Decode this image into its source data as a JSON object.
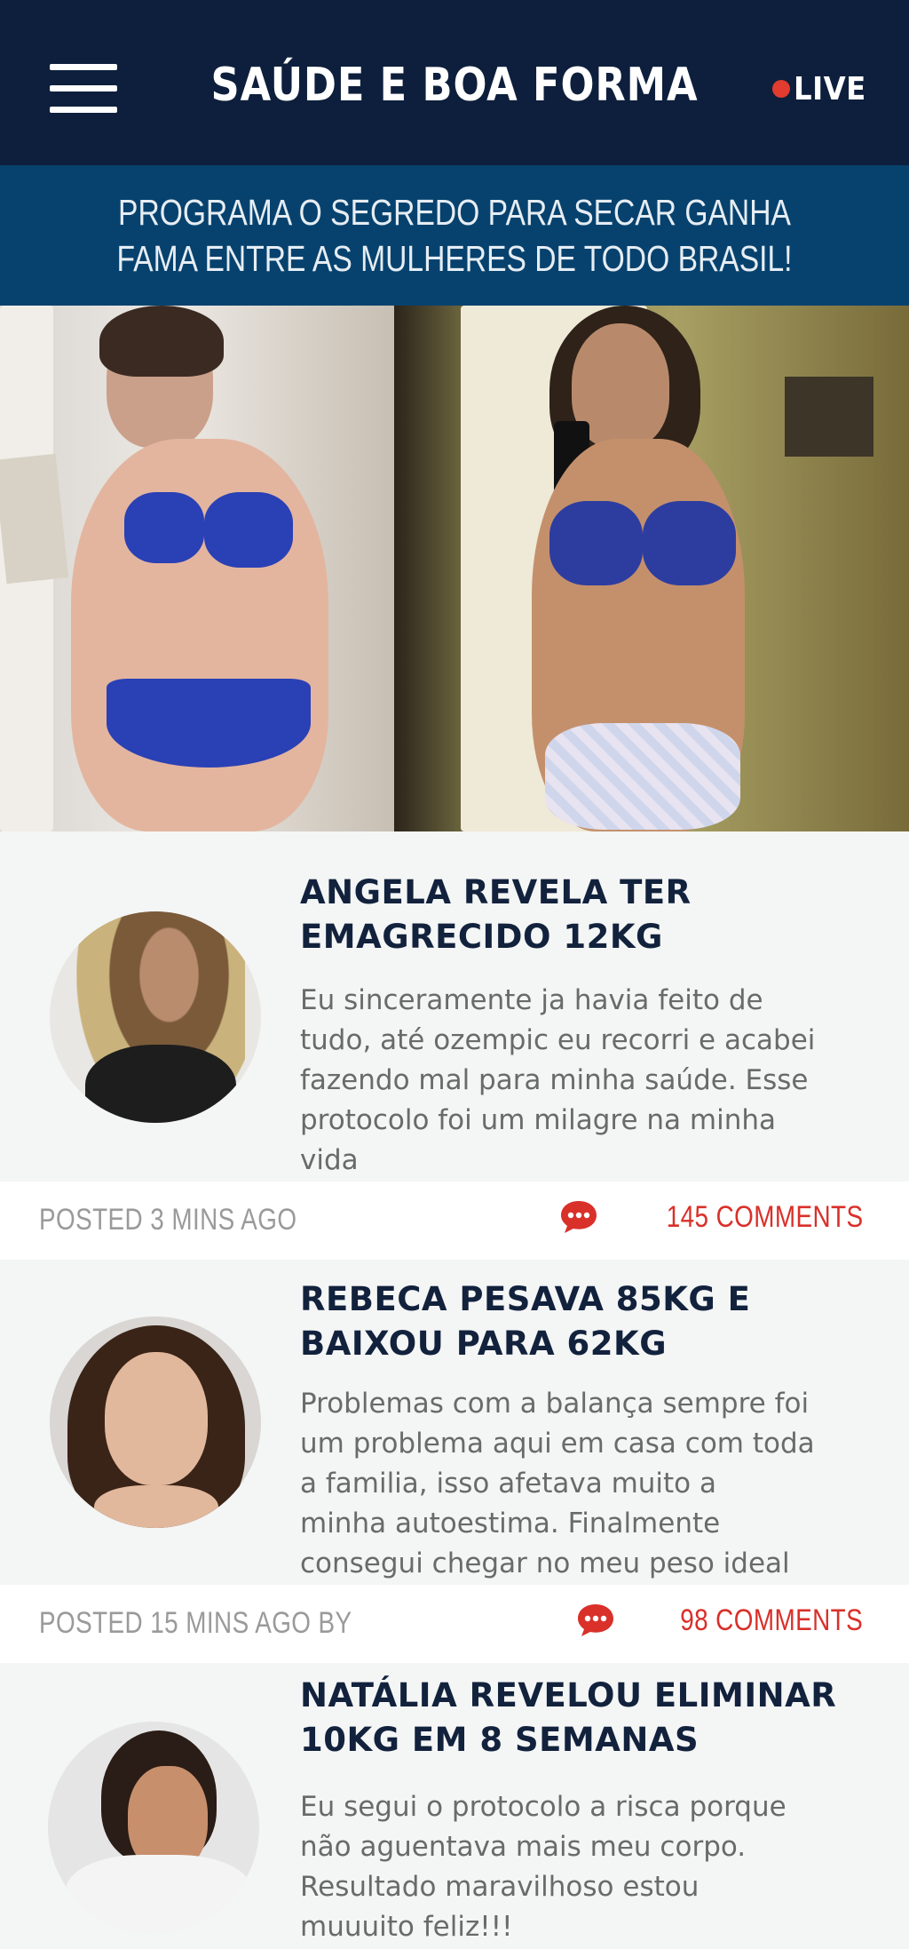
{
  "header": {
    "site_title": "SAÚDE E BOA FORMA",
    "live_label": "LIVE",
    "colors": {
      "background": "#0d1f3c",
      "live_dot": "#e23b2f"
    }
  },
  "banner": {
    "line1": "PROGRAMA O SEGREDO PARA SECAR GANHA",
    "line2": "FAMA ENTRE AS MULHERES DE TODO BRASIL!",
    "background": "#07426e"
  },
  "posts": [
    {
      "title_line1": "ANGELA REVELA TER",
      "title_line2": "EMAGRECIDO 12KG",
      "text_lines": [
        "Eu sinceramente ja havia feito de",
        "tudo, até ozempic eu recorri e acabei",
        "fazendo mal para minha saúde. Esse",
        "protocolo foi um milagre na minha",
        "vida"
      ],
      "posted": "POSTED 3 MINS AGO",
      "comments": "145 COMMENTS"
    },
    {
      "title_line1": "REBECA PESAVA 85KG E",
      "title_line2": "BAIXOU PARA 62KG",
      "text_lines": [
        "Problemas com a balança sempre foi",
        "um problema aqui em casa com toda",
        "a familia, isso afetava muito a",
        "minha autoestima. Finalmente",
        "consegui chegar no meu peso ideal"
      ],
      "posted": "POSTED 15 MINS AGO BY",
      "comments": "98 COMMENTS"
    },
    {
      "title_line1": "NATÁLIA REVELOU ELIMINAR",
      "title_line2": "10KG EM 8 SEMANAS",
      "text_lines": [
        "Eu segui o protocolo a risca porque",
        "não aguentava mais meu corpo.",
        "Resultado maravilhoso estou",
        "muuuito feliz!!!"
      ]
    }
  ],
  "icons": {
    "menu": "hamburger-menu-icon",
    "comments": "speech-bubble-icon"
  },
  "accent_comment_color": "#d9302a"
}
